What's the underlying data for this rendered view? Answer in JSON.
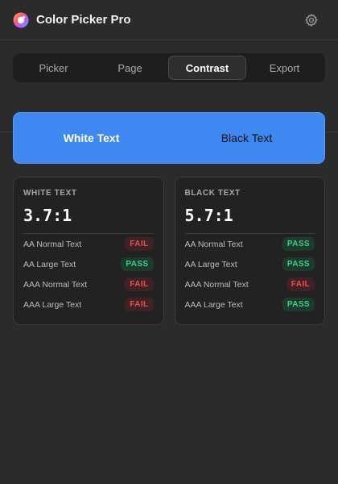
{
  "app": {
    "title": "Color Picker Pro",
    "logo_icon": "color-wheel-icon",
    "settings_icon": "gear-icon"
  },
  "tabs": [
    {
      "label": "Picker",
      "active": false
    },
    {
      "label": "Page",
      "active": false
    },
    {
      "label": "Contrast",
      "active": true
    },
    {
      "label": "Export",
      "active": false
    }
  ],
  "preview": {
    "background": "#3f88f2",
    "white_sample": "White Text",
    "black_sample": "Black Text"
  },
  "white_card": {
    "label": "WHITE TEXT",
    "ratio": "3.7:1",
    "checks": [
      {
        "label": "AA Normal Text",
        "result": "FAIL"
      },
      {
        "label": "AA Large Text",
        "result": "PASS"
      },
      {
        "label": "AAA Normal Text",
        "result": "FAIL"
      },
      {
        "label": "AAA Large Text",
        "result": "FAIL"
      }
    ]
  },
  "black_card": {
    "label": "BLACK TEXT",
    "ratio": "5.7:1",
    "checks": [
      {
        "label": "AA Normal Text",
        "result": "PASS"
      },
      {
        "label": "AA Large Text",
        "result": "PASS"
      },
      {
        "label": "AAA Normal Text",
        "result": "FAIL"
      },
      {
        "label": "AAA Large Text",
        "result": "PASS"
      }
    ]
  },
  "colors": {
    "pass": "#3ed08a",
    "fail": "#ef4d55",
    "accent": "#3f88f2"
  }
}
